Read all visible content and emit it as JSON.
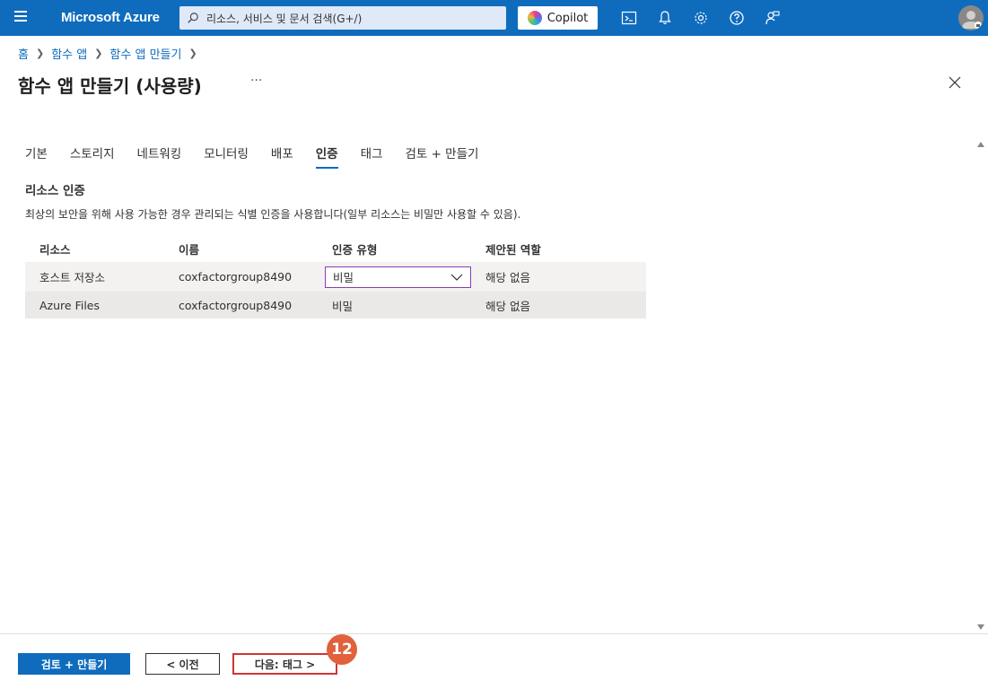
{
  "topbar": {
    "brand": "Microsoft Azure",
    "search_placeholder": "리소스, 서비스 및 문서 검색(G+/)",
    "copilot_label": "Copilot",
    "icons": [
      "cloud-shell-icon",
      "bell-icon",
      "gear-icon",
      "help-icon",
      "feedback-icon"
    ]
  },
  "breadcrumb": {
    "items": [
      "홈",
      "함수 앱",
      "함수 앱 만들기"
    ]
  },
  "page": {
    "title": "함수 앱 만들기 (사용량)",
    "more": "···"
  },
  "tabs": [
    {
      "label": "기본"
    },
    {
      "label": "스토리지"
    },
    {
      "label": "네트워킹"
    },
    {
      "label": "모니터링"
    },
    {
      "label": "배포"
    },
    {
      "label": "인증",
      "active": true
    },
    {
      "label": "태그"
    },
    {
      "label": "검토 + 만들기"
    }
  ],
  "section": {
    "title": "리소스 인증",
    "description": "최상의 보안을 위해 사용 가능한 경우 관리되는 식별 인증을 사용합니다(일부 리소스는 비밀만 사용할 수 있음)."
  },
  "table": {
    "headers": [
      "리소스",
      "이름",
      "인증 유형",
      "제안된 역할"
    ],
    "rows": [
      {
        "resource": "호스트 저장소",
        "name": "coxfactorgroup8490",
        "auth_type": "비밀",
        "role": "해당 없음"
      },
      {
        "resource": "Azure Files",
        "name": "coxfactorgroup8490",
        "auth_type": "비밀",
        "role": "해당 없음"
      }
    ]
  },
  "footer": {
    "review_create": "검토 + 만들기",
    "previous": "< 이전",
    "next": "다음: 태그 >",
    "step_badge": "12"
  },
  "colors": {
    "accent": "#0f6cbd",
    "highlight": "#d13438",
    "badge": "#e0613c"
  }
}
